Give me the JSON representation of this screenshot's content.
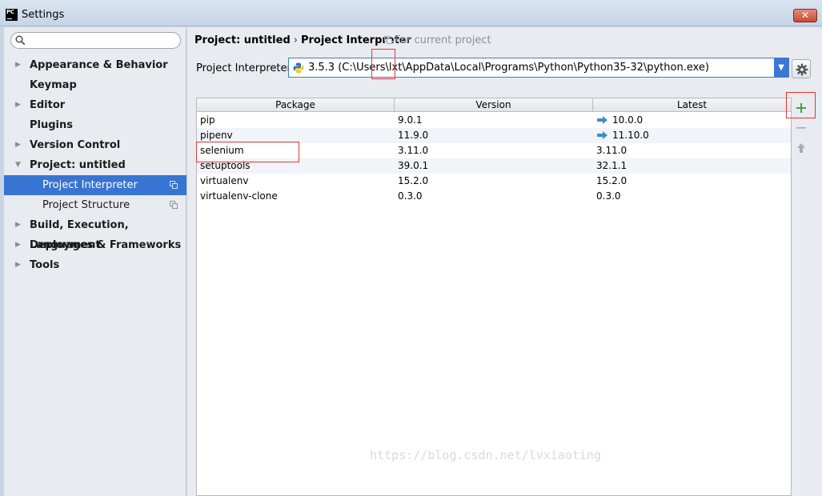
{
  "window": {
    "app_icon_text": "PC",
    "title": "Settings",
    "close_label": "✕"
  },
  "sidebar": {
    "search": {
      "value": "",
      "placeholder": ""
    },
    "items": [
      {
        "label": "Appearance & Behavior",
        "expandable": true
      },
      {
        "label": "Keymap",
        "expandable": false
      },
      {
        "label": "Editor",
        "expandable": true
      },
      {
        "label": "Plugins",
        "expandable": false
      },
      {
        "label": "Version Control",
        "expandable": true
      },
      {
        "label": "Project: untitled",
        "expandable": true,
        "expanded": true
      },
      {
        "label": "Project Interpreter",
        "sub": true,
        "selected": true,
        "icon": "copy-icon"
      },
      {
        "label": "Project Structure",
        "sub": true,
        "icon": "copy-icon"
      },
      {
        "label": "Build, Execution, Deployment",
        "expandable": true
      },
      {
        "label": "Languages & Frameworks",
        "expandable": true
      },
      {
        "label": "Tools",
        "expandable": true
      }
    ]
  },
  "main": {
    "breadcrumb": {
      "parent": "Project: untitled",
      "separator": "›",
      "current": "Project Interpreter"
    },
    "scope_note": "For current project",
    "interpreter": {
      "label": "Project Interpreter:",
      "value": "3.5.3 (C:\\Users\\lxt\\AppData\\Local\\Programs\\Python\\Python35-32\\python.exe)"
    },
    "table": {
      "columns": [
        "Package",
        "Version",
        "Latest"
      ],
      "rows": [
        {
          "package": "pip",
          "version": "9.0.1",
          "latest": "10.0.0",
          "upgrade": true
        },
        {
          "package": "pipenv",
          "version": "11.9.0",
          "latest": "11.10.0",
          "upgrade": true
        },
        {
          "package": "selenium",
          "version": "3.11.0",
          "latest": "3.11.0",
          "upgrade": false
        },
        {
          "package": "setuptools",
          "version": "39.0.1",
          "latest": "32.1.1",
          "upgrade": false
        },
        {
          "package": "virtualenv",
          "version": "15.2.0",
          "latest": "15.2.0",
          "upgrade": false
        },
        {
          "package": "virtualenv-clone",
          "version": "0.3.0",
          "latest": "0.3.0",
          "upgrade": false
        }
      ]
    },
    "tools": {
      "add_icon": "plus-icon",
      "remove_icon": "minus-icon",
      "upgrade_icon": "up-arrow-icon"
    }
  },
  "colors": {
    "selection": "#3874d2",
    "highlight_box": "#e33333",
    "add": "#3aa83a",
    "upgrade_arrow": "#3d8bd2"
  },
  "watermark": "https://blog.csdn.net/lvxiaoting"
}
